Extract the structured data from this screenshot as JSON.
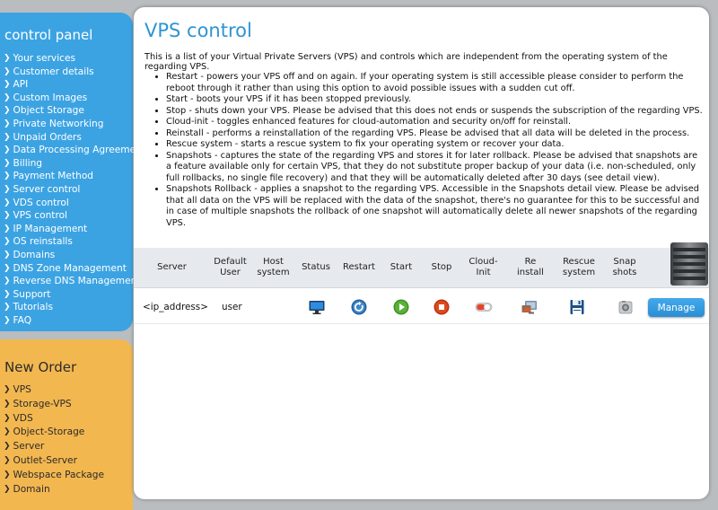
{
  "sidebar": {
    "title": "control panel",
    "items": [
      "Your services",
      "Customer details",
      "API",
      "Custom Images",
      "Object Storage",
      "Private Networking",
      "Unpaid Orders",
      "Data Processing Agreement",
      "Billing",
      "Payment Method",
      "Server control",
      "VDS control",
      "VPS control",
      "IP Management",
      "OS reinstalls",
      "Domains",
      "DNS Zone Management",
      "Reverse DNS Management",
      "Support",
      "Tutorials",
      "FAQ"
    ]
  },
  "new_order": {
    "title": "New Order",
    "items": [
      "VPS",
      "Storage-VPS",
      "VDS",
      "Object-Storage",
      "Server",
      "Outlet-Server",
      "Webspace Package",
      "Domain"
    ]
  },
  "main": {
    "title": "VPS control",
    "intro": "This is a list of your Virtual Private Servers (VPS) and controls which are independent from the operating system of the regarding VPS.",
    "bullets": [
      "Restart - powers your VPS off and on again. If your operating system is still accessible please consider to perform the reboot through it rather than using this option to avoid possible issues with a sudden cut off.",
      "Start - boots your VPS if it has been stopped previously.",
      "Stop - shuts down your VPS. Please be advised that this does not ends or suspends the subscription of the regarding VPS.",
      "Cloud-init - toggles enhanced features for cloud-automation and security on/off for reinstall.",
      "Reinstall - performs a reinstallation of the regarding VPS. Please be advised that all data will be deleted in the process.",
      "Rescue system - starts a rescue system to fix your operating system or recover your data.",
      "Snapshots - captures the state of the regarding VPS and stores it for later rollback. Please be advised that snapshots are a feature available only for certain VPS, that they do not substitute proper backup of your data (i.e. non-scheduled, only full rollbacks, no single file recovery) and that they will be automatically deleted after 30 days (see detail view).",
      "Snapshots Rollback - applies a snapshot to the regarding VPS. Accessible in the Snapshots detail view. Please be advised that all data on the VPS will be replaced with the data of the snapshot, there's no guarantee for this to be successful and in case of multiple snapshots the rollback of one snapshot will automatically delete all newer snapshots of the regarding VPS."
    ]
  },
  "table": {
    "headers": {
      "server": "Server",
      "default_user": "Default User",
      "host_system": "Host system",
      "status": "Status",
      "restart": "Restart",
      "start": "Start",
      "stop": "Stop",
      "cloud_init": "Cloud-Init",
      "reinstall": "Re install",
      "rescue": "Rescue system",
      "snapshots": "Snap shots"
    },
    "row": {
      "server": "<ip_address>",
      "default_user": "user",
      "manage_label": "Manage",
      "icons": [
        "monitor-icon",
        "restart-icon",
        "start-icon",
        "stop-icon",
        "toggle-icon",
        "reinstall-icon",
        "floppy-disk-icon",
        "snapshot-icon"
      ]
    }
  },
  "colors": {
    "control_panel_bg": "#3ca3e3",
    "new_order_bg": "#f3b74f",
    "title_blue": "#2e95d3",
    "manage_button": "#2b8ed3",
    "start_green": "#5cb03a",
    "stop_orange": "#dd4a1c"
  }
}
